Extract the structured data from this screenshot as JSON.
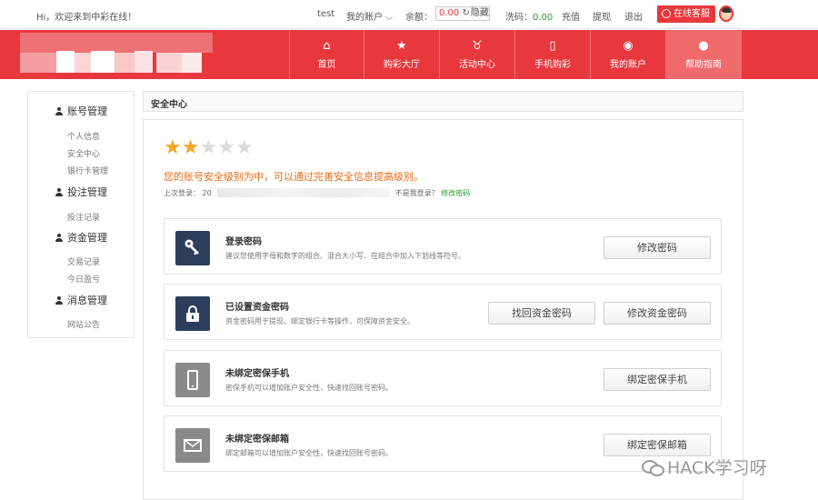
{
  "topbar": {
    "greeting": "Hi，欢迎来到中彩在线！",
    "username": "test",
    "my_account": "我的账户",
    "my_account_chevron": "chevron-down-icon",
    "balance_label": "余额：",
    "balance_value": "0.00",
    "refresh_icon": "refresh-icon",
    "hide_label": "隐藏",
    "wash_label": "洗码：",
    "wash_value": "0.00",
    "recharge": "充值",
    "withdraw": "提现",
    "logout": "退出",
    "online_service": "在线客服",
    "online_service_icon": "headset-icon"
  },
  "nav": {
    "items": [
      {
        "label": "首页",
        "icon": "home-icon",
        "glyph": "⌂"
      },
      {
        "label": "购彩大厅",
        "icon": "star-icon",
        "glyph": "★"
      },
      {
        "label": "活动中心",
        "icon": "money-bag-icon",
        "glyph": "♉"
      },
      {
        "label": "手机购彩",
        "icon": "mobile-icon",
        "glyph": "▯"
      },
      {
        "label": "我的账户",
        "icon": "user-circle-icon",
        "glyph": "◉"
      },
      {
        "label": "帮助指南",
        "icon": "help-icon",
        "glyph": "●"
      }
    ],
    "active_index": 5
  },
  "sidebar": {
    "groups": [
      {
        "title": "账号管理",
        "items": [
          "个人信息",
          "安全中心",
          "银行卡管理"
        ]
      },
      {
        "title": "投注管理",
        "items": [
          "投注记录"
        ]
      },
      {
        "title": "资金管理",
        "items": [
          "交易记录",
          "今日盈亏"
        ]
      },
      {
        "title": "消息管理",
        "items": [
          "网站公告"
        ]
      }
    ]
  },
  "section_title": "安全中心",
  "security": {
    "rating": 2,
    "max_rating": 5,
    "level_text": "您的账号安全级别为中，可以通过完善安全信息提高级别。",
    "last_login_label": "上次登录：",
    "last_login_value": "20",
    "not_me_text": "不是我登录？",
    "change_password_link": "修改密码"
  },
  "cards": [
    {
      "title": "登录密码",
      "desc": "建议您使用字母和数字的组合、混合大小写、在组合中加入下划线等符号。",
      "icon": "key-icon",
      "buttons": [
        "修改密码"
      ]
    },
    {
      "title": "已设置资金密码",
      "desc": "资金密码用于提现、绑定银行卡等操作，可保障资金安全。",
      "icon": "lock-icon",
      "buttons": [
        "找回资金密码",
        "修改资金密码"
      ]
    },
    {
      "title": "未绑定密保手机",
      "desc": "密保手机可以增加账户安全性，快速找回账号密码。",
      "icon": "phone-icon",
      "buttons": [
        "绑定密保手机"
      ]
    },
    {
      "title": "未绑定密保邮箱",
      "desc": "绑定邮箱可以增加账户安全性，快速找回账号密码。",
      "icon": "mail-icon",
      "buttons": [
        "绑定密保邮箱"
      ]
    }
  ],
  "colors": {
    "brand_red": "#e8383d",
    "star": "#f5a623",
    "warning_orange": "#e86a14",
    "link_green": "#2a9a2a",
    "icon_dark": "#2c3e5c",
    "icon_gray": "#8a8a8a"
  },
  "watermark": "HACK学习呀"
}
